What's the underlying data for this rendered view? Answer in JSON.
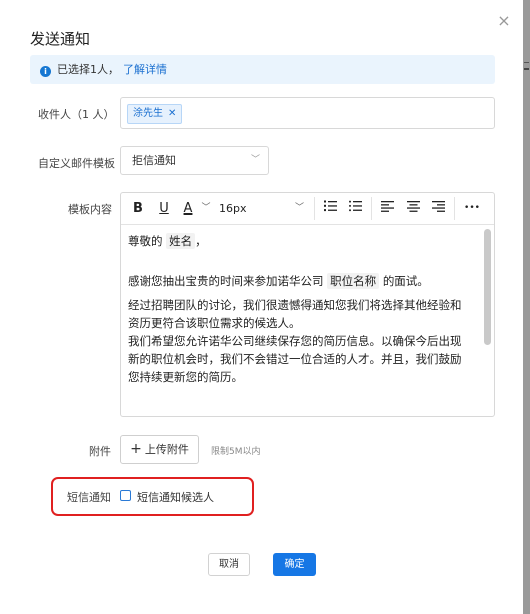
{
  "dialog": {
    "title": "发送通知",
    "close_glyph": "×"
  },
  "info": {
    "icon": "info-icon",
    "text": "已选择1人，",
    "link": "了解详情"
  },
  "recipients": {
    "label": "收件人（1 人）",
    "tags": [
      "涂先生"
    ]
  },
  "template": {
    "label": "自定义邮件模板",
    "value": "拒信通知"
  },
  "editor": {
    "label": "模板内容",
    "toolbar": {
      "bold": "B",
      "underline": "U",
      "font_color": "A",
      "font_size": "16px",
      "more": "•••"
    },
    "content": {
      "greeting_prefix": "尊敬的",
      "greeting_var": "姓名",
      "greeting_suffix": "，",
      "p1_prefix": "感谢您抽出宝贵的时间来参加诺华公司",
      "p1_var": "职位名称",
      "p1_suffix": "的面试。",
      "p2": "经过招聘团队的讨论，我们很遗憾得通知您我们将选择其他经验和资历更符合该职位需求的候选人。",
      "p3": "我们希望您允许诺华公司继续保存您的简历信息。以确保今后出现新的职位机会时，我们不会错过一位合适的人才。并且，我们鼓励您持续更新您的简历。"
    }
  },
  "attachment": {
    "label": "附件",
    "button": "上传附件",
    "hint": "限制5M以内"
  },
  "sms": {
    "label": "短信通知",
    "checkbox_label": "短信通知候选人",
    "checked": false
  },
  "footer": {
    "cancel": "取消",
    "confirm": "确定"
  },
  "colors": {
    "primary": "#1677e5",
    "highlight_border": "#e02020",
    "info_bg": "#eaf4fd"
  }
}
